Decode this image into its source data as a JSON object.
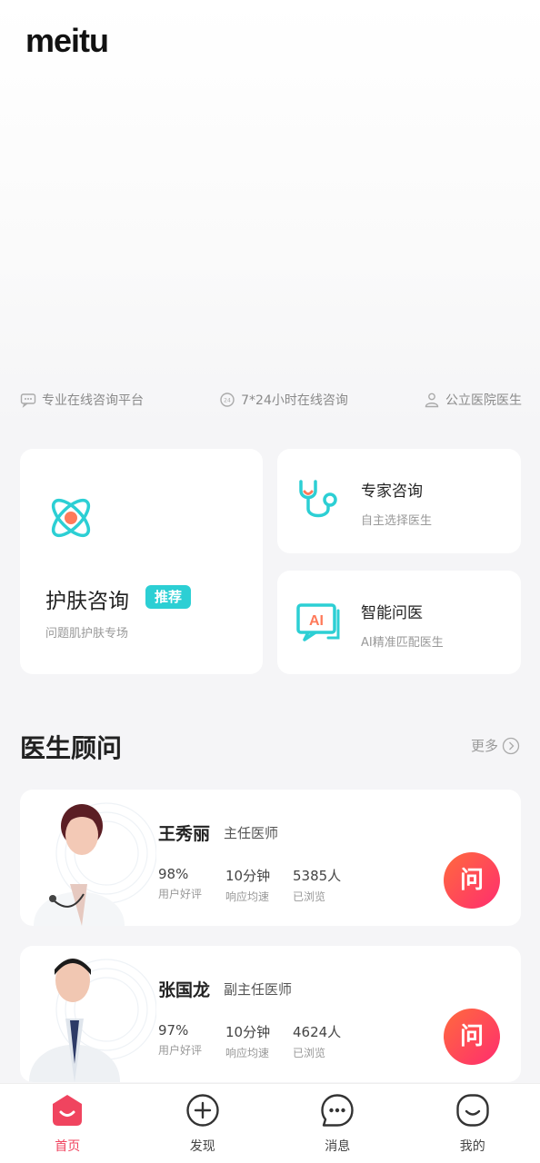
{
  "brand": {
    "logo_text": "meitu"
  },
  "features": [
    {
      "label": "专业在线咨询平台",
      "icon": "chat-icon"
    },
    {
      "label": "7*24小时在线咨询",
      "icon": "clock-24-icon"
    },
    {
      "label": "公立医院医生",
      "icon": "doctor-icon"
    }
  ],
  "services": {
    "skin": {
      "title": "护肤咨询",
      "badge": "推荐",
      "subtitle": "问题肌护肤专场"
    },
    "expert": {
      "title": "专家咨询",
      "subtitle": "自主选择医生"
    },
    "ai": {
      "title": "智能问医",
      "subtitle": "AI精准匹配医生",
      "icon_text": "AI"
    }
  },
  "doctors_section": {
    "title": "医生顾问",
    "more_label": "更多"
  },
  "doctors": [
    {
      "name": "王秀丽",
      "rank": "主任医师",
      "rating": "98%",
      "rating_label": "用户好评",
      "response": "10分钟",
      "response_label": "响应均速",
      "views": "5385人",
      "views_label": "已浏览",
      "ask_label": "问"
    },
    {
      "name": "张国龙",
      "rank": "副主任医师",
      "rating": "97%",
      "rating_label": "用户好评",
      "response": "10分钟",
      "response_label": "响应均速",
      "views": "4624人",
      "views_label": "已浏览",
      "ask_label": "问"
    }
  ],
  "tabbar": [
    {
      "label": "首页",
      "active": true,
      "icon": "home-icon"
    },
    {
      "label": "发现",
      "active": false,
      "icon": "plus-circle-icon"
    },
    {
      "label": "消息",
      "active": false,
      "icon": "message-icon"
    },
    {
      "label": "我的",
      "active": false,
      "icon": "profile-icon"
    }
  ],
  "colors": {
    "accent": "#f0445f",
    "teal": "#2ccfd4",
    "ask_gradient_start": "#ff6a3d",
    "ask_gradient_end": "#ff2d6f"
  }
}
